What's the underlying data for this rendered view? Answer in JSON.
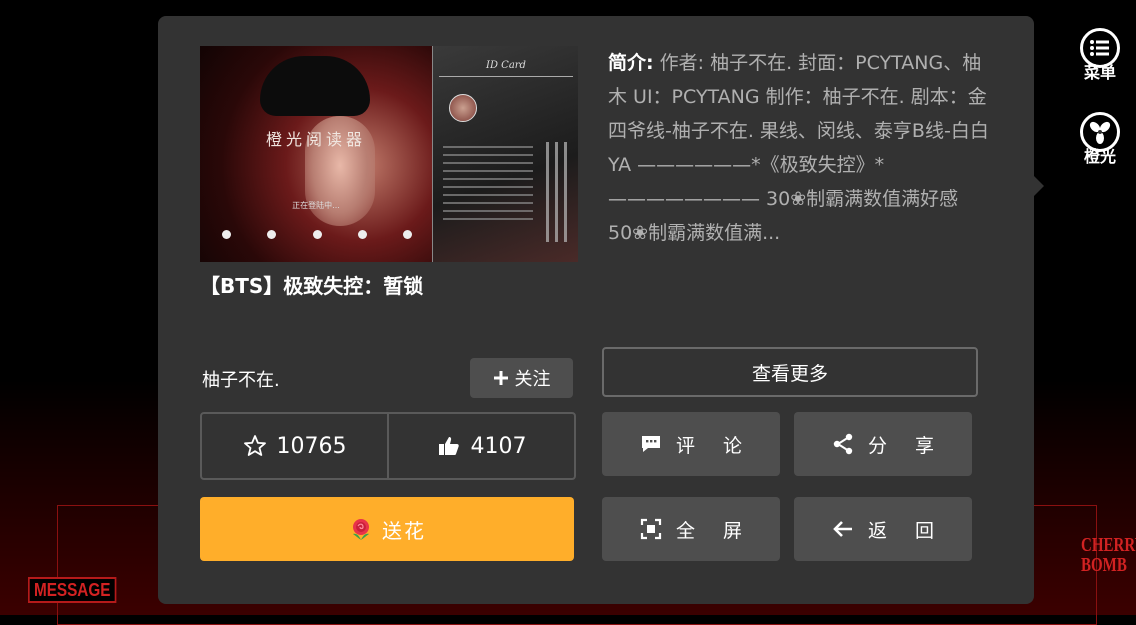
{
  "background": {
    "message_tag": "MESSAGE",
    "cherry_bomb_logo": "CHERRY BOMB"
  },
  "side_menu": {
    "menu_label": "菜单",
    "theme_label": "橙光",
    "menu_icon": "list-icon",
    "theme_icon": "fan-icon"
  },
  "cover": {
    "brand_logo": "橙光阅读器",
    "brand_title": "橙光阅读器",
    "loading": "正在登陆中...",
    "idcard": "ID Card"
  },
  "book": {
    "title": "【BTS】极致失控：暂锁",
    "intro_label": "简介:",
    "intro_text": "作者: 柚子不在. 封面：PCYTANG、柚木 UI：PCYTANG 制作：柚子不在. 剧本：金四爷线-柚子不在. 果线、闵线、泰亨B线-白白YA ——————*《极致失控》*———————— 30❀制霸满数值满好感 50❀制霸满数值满..."
  },
  "author": {
    "name": "柚子不在.",
    "follow_label": "关注",
    "follow_icon": "plus-icon"
  },
  "stats": {
    "favorites": "10765",
    "likes": "4107",
    "favorites_icon": "star-icon",
    "likes_icon": "thumbs-up-icon"
  },
  "actions": {
    "flower_label": "送花",
    "flower_icon": "rose-icon",
    "more_label": "查看更多",
    "comment_label": "评论",
    "share_label": "分享",
    "fullscreen_label": "全屏",
    "back_label": "返回",
    "comment_icon": "chat-icon",
    "share_icon": "share-icon",
    "fullscreen_icon": "fullscreen-icon",
    "back_icon": "arrow-left-icon"
  },
  "colors": {
    "panel": "#333333",
    "button": "#4e4e4e",
    "flower_button": "#ffae2a",
    "accent_red": "#d22222"
  }
}
